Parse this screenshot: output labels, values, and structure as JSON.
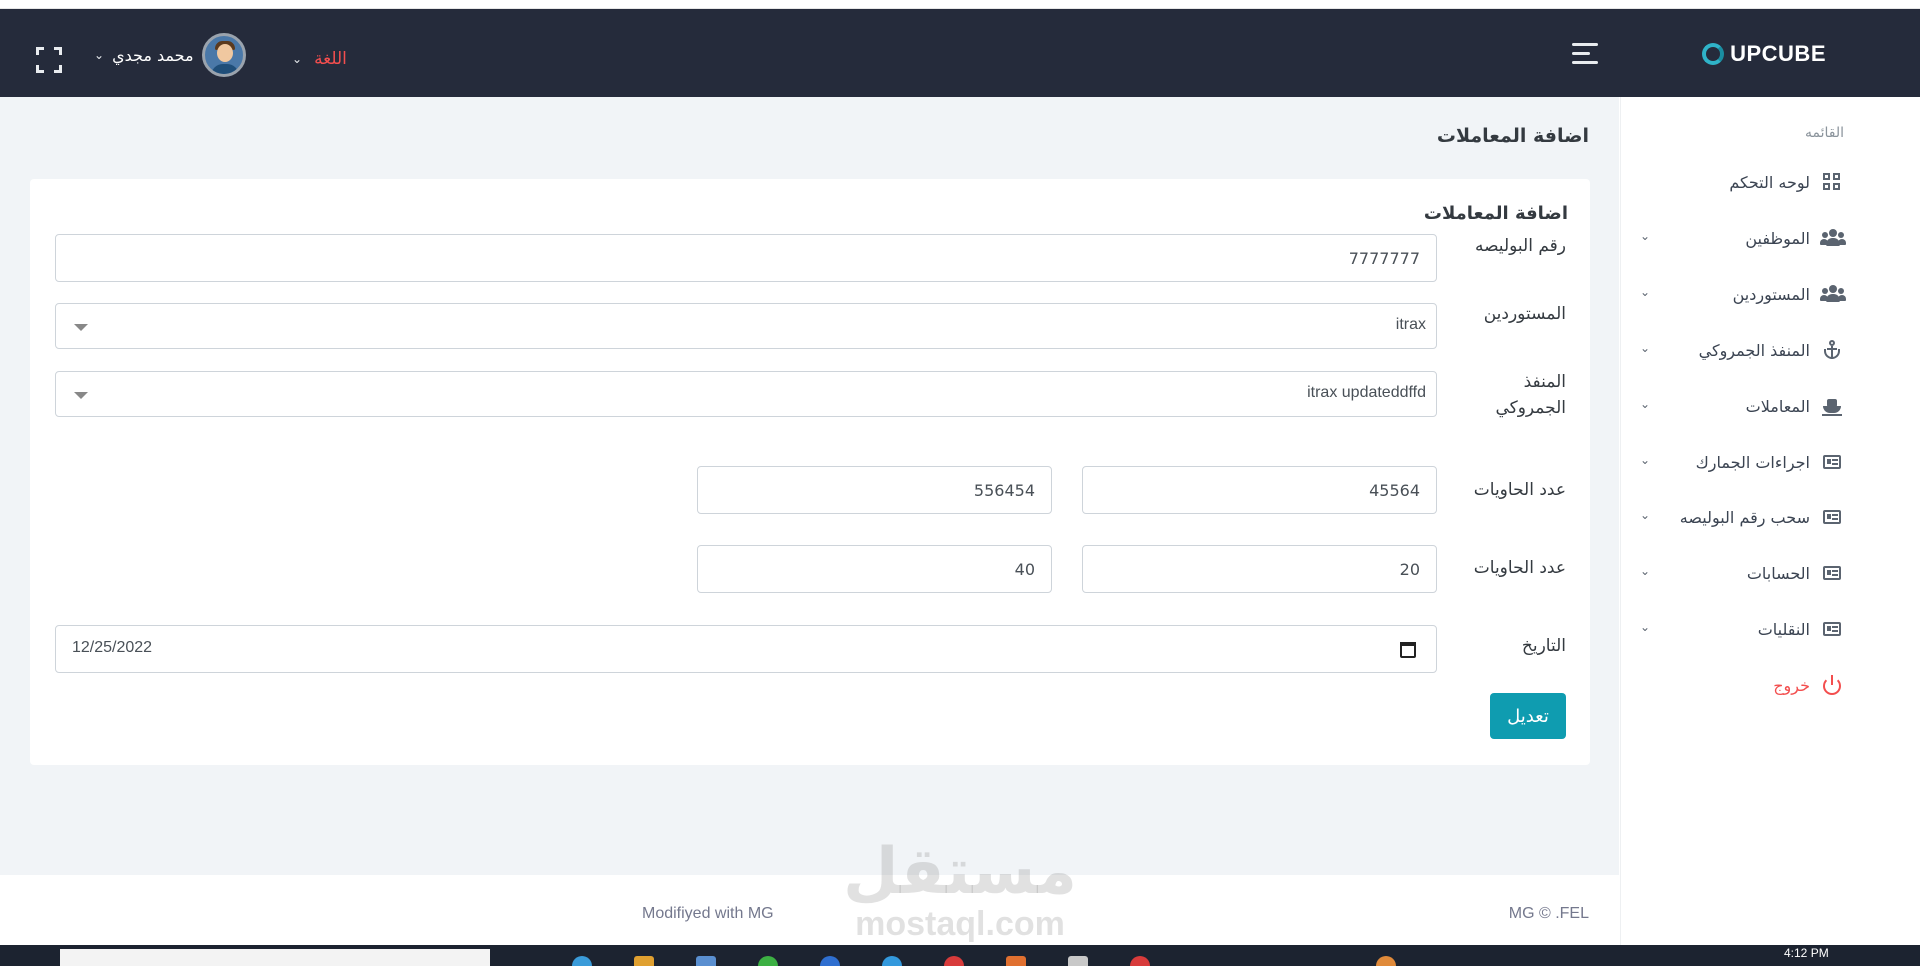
{
  "header": {
    "brand": "UPCUBE",
    "language_label": "اللغة",
    "user_name": "محمد مجدي"
  },
  "sidebar": {
    "title": "القائمه",
    "items": [
      {
        "label": "لوحه التحكم",
        "icon": "dashboard-grid-icon"
      },
      {
        "label": "الموظفين",
        "icon": "users-icon"
      },
      {
        "label": "المستوردين",
        "icon": "users-icon"
      },
      {
        "label": "المنفذ الجمروكي",
        "icon": "anchor-icon"
      },
      {
        "label": "المعاملات",
        "icon": "ship-icon"
      },
      {
        "label": "اجراءات الجمارك",
        "icon": "newspaper-icon"
      },
      {
        "label": "سحب رقم البوليصه",
        "icon": "newspaper-icon"
      },
      {
        "label": "الحسابات",
        "icon": "newspaper-icon"
      },
      {
        "label": "النقليات",
        "icon": "newspaper-icon"
      }
    ],
    "logout_label": "خروج"
  },
  "page": {
    "title": "اضافة المعاملات"
  },
  "form": {
    "card_title": "اضافة المعاملات",
    "policy_label": "رقم البوليصه",
    "policy_value": "7777777",
    "importers_label": "المستوردين",
    "importers_value": "itrax",
    "port_label": "المنفذ الجمروكي",
    "port_value": "itrax updateddffd",
    "containers_label_1": "عدد الحاويات",
    "containers_a1": "45564",
    "containers_b1": "556454",
    "containers_label_2": "عدد الحاويات",
    "containers_a2": "20",
    "containers_b2": "40",
    "date_label": "التاريخ",
    "date_value": "12/25/2022",
    "submit_label": "تعديل"
  },
  "footer": {
    "left": "Modifiyed with MG",
    "right": "MG © .FEL"
  },
  "watermark": {
    "arabic": "مستقل",
    "latin": "mostaql.com"
  },
  "taskbar": {
    "time": "4:12 PM"
  },
  "colors": {
    "topbar": "#252b3b",
    "accent": "#0f9cb0",
    "danger": "#f34e4e",
    "content_bg": "#f1f4f7"
  }
}
